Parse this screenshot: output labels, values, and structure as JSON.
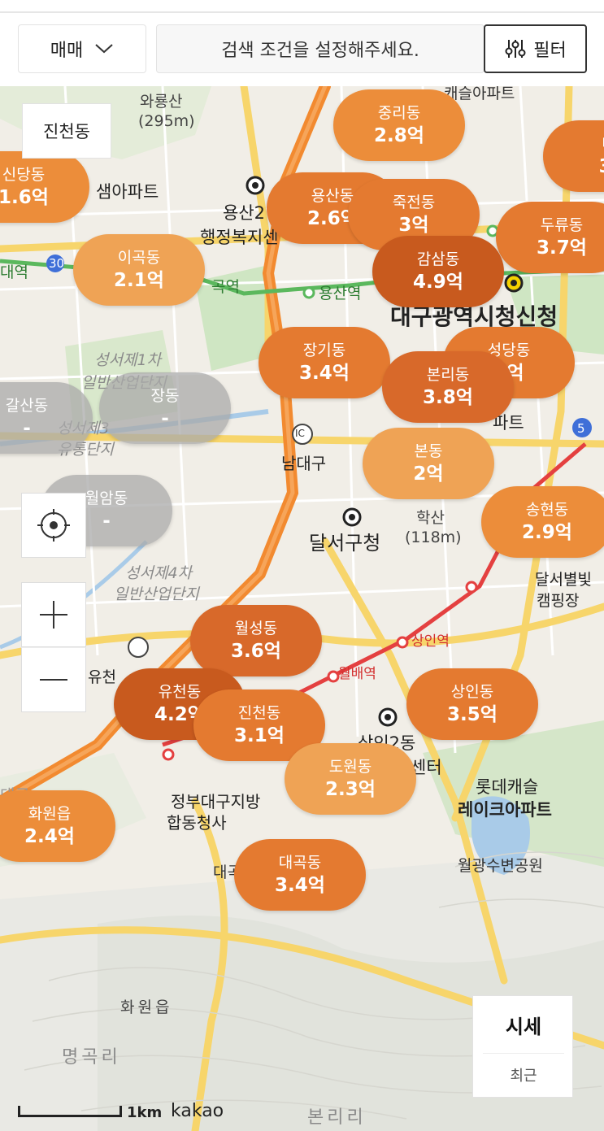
{
  "toolbar": {
    "trade_type": "매매",
    "search_placeholder": "검색 조건을 설정해주세요.",
    "filter_label": "필터"
  },
  "region": {
    "label": "진천동"
  },
  "map_labels": [
    "와룡산",
    "(295m)",
    "샘아파트",
    "용산2",
    "행정복지센",
    "대역",
    "30",
    "곡역",
    "용산역",
    "대구광역시청신청",
    "성서제1차",
    "일반산업단지",
    "성서제3",
    "유통단지",
    "남대구",
    "IC",
    "달서구청",
    "학산",
    "(118m)",
    "성서제4차",
    "일반산업단지",
    "유천",
    "상인역",
    "월배역",
    "대곡",
    "상인2동",
    "센터",
    "롯데캐슬",
    "레이크아파트",
    "정부대구지방",
    "합동청사",
    "월광수변공원",
    "대곡",
    "화원읍",
    "명곡리",
    "본리리",
    "달서별빛",
    "캠핑장",
    "5",
    "캐슬아파트",
    "파트",
    "대구"
  ],
  "bubbles": [
    {
      "name": "중리동",
      "price": "2.8억"
    },
    {
      "name": "내",
      "price": "3."
    },
    {
      "name": "신당동",
      "price": "1.6억"
    },
    {
      "name": "용산동",
      "price": "2.6억"
    },
    {
      "name": "죽전동",
      "price": "3억"
    },
    {
      "name": "두류동",
      "price": "3.7억"
    },
    {
      "name": "이곡동",
      "price": "2.1억"
    },
    {
      "name": "감삼동",
      "price": "4.9억"
    },
    {
      "name": "장기동",
      "price": "3.4억"
    },
    {
      "name": "성당동",
      "price": "3억"
    },
    {
      "name": "본리동",
      "price": "3.8억"
    },
    {
      "name": "갈산동",
      "price": "-"
    },
    {
      "name": "장동",
      "price": "-"
    },
    {
      "name": "본동",
      "price": "2억"
    },
    {
      "name": "월암동",
      "price": "-"
    },
    {
      "name": "송현동",
      "price": "2.9억"
    },
    {
      "name": "월성동",
      "price": "3.6억"
    },
    {
      "name": "유천동",
      "price": "4.2억"
    },
    {
      "name": "진천동",
      "price": "3.1억"
    },
    {
      "name": "상인동",
      "price": "3.5억"
    },
    {
      "name": "도원동",
      "price": "2.3억"
    },
    {
      "name": "화원읍",
      "price": "2.4억"
    },
    {
      "name": "대곡동",
      "price": "3.4억"
    }
  ],
  "price_card": {
    "title": "시세",
    "subtitle": "최근"
  },
  "scale": {
    "label": "1km"
  },
  "logo": "kakao",
  "colors": {
    "highway": "#f28a30",
    "road": "#f7d56b",
    "subway": "#5bb85d",
    "park": "#cfe6c3",
    "water": "#a9cbe8"
  }
}
